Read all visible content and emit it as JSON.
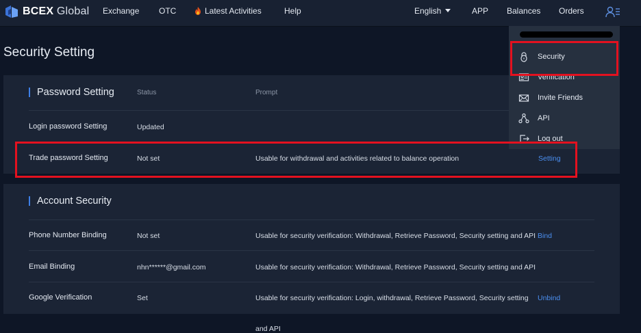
{
  "nav": {
    "logo_bold": "BCEX",
    "logo_rest": " Global",
    "exchange": "Exchange",
    "otc": "OTC",
    "latest_activities": "Latest Activities",
    "help": "Help",
    "language": "English",
    "app": "APP",
    "balances": "Balances",
    "orders": "Orders"
  },
  "page_title": "Security Setting",
  "password_section": {
    "title": "Password Setting",
    "col_status": "Status",
    "col_prompt": "Prompt",
    "rows": [
      {
        "label": "Login password Setting",
        "status": "Updated",
        "prompt": "",
        "action": ""
      },
      {
        "label": "Trade password Setting",
        "status": "Not set",
        "prompt": "Usable for withdrawal and activities related to balance operation",
        "action": "Setting"
      }
    ]
  },
  "account_section": {
    "title": "Account Security",
    "rows": [
      {
        "label": "Phone Number Binding",
        "status": "Not set",
        "prompt": "Usable for security verification: Withdrawal, Retrieve Password, Security setting and API",
        "action": "Bind"
      },
      {
        "label": "Email Binding",
        "status": "nhn******@gmail.com",
        "prompt": "Usable for security verification: Withdrawal, Retrieve Password, Security setting and API",
        "action": ""
      },
      {
        "label": "Google Verification",
        "status": "Set",
        "prompt": "Usable for security verification: Login, withdrawal, Retrieve Password, Security setting",
        "prompt_cont": "and API",
        "action": "Unbind"
      }
    ]
  },
  "dropdown": {
    "security": "Security",
    "verification": "Verification",
    "invite_friends": "Invite Friends",
    "api": "API",
    "logout": "Log out"
  },
  "colors": {
    "accent_link": "#4b8ff0",
    "highlight": "#e4111f",
    "panel": "#1b2435",
    "background": "#0e1626"
  },
  "icons": [
    "logo-icon",
    "flame-icon",
    "caret-down-icon",
    "user-menu-icon",
    "lock-icon",
    "id-card-icon",
    "envelope-icon",
    "network-icon",
    "logout-icon"
  ]
}
